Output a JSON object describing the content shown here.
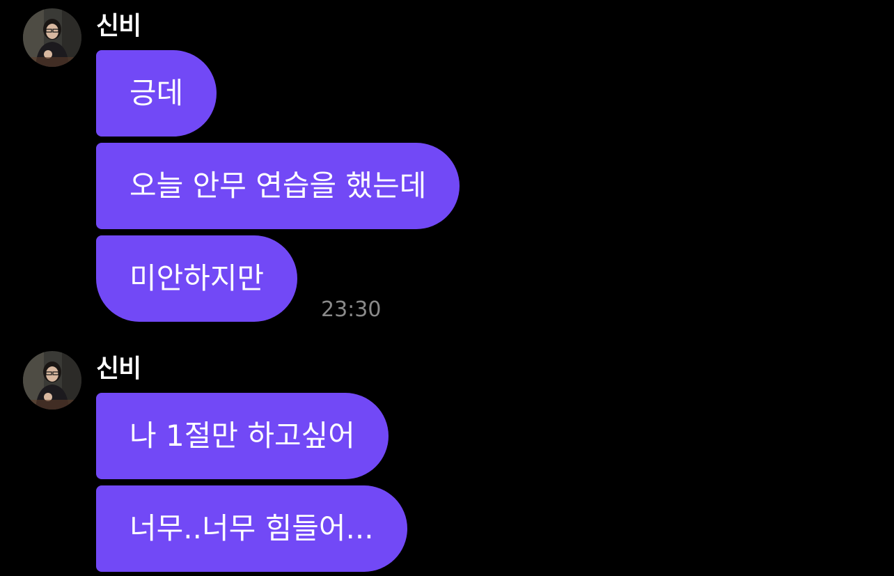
{
  "chat": {
    "groups": [
      {
        "sender": "신비",
        "avatar": "profile-photo",
        "messages": [
          "긍데",
          "오늘 안무 연습을 했는데",
          "미안하지만"
        ],
        "time": "23:30"
      },
      {
        "sender": "신비",
        "avatar": "profile-photo",
        "messages": [
          "나 1절만 하고싶어",
          "너무..너무 힘들어..."
        ]
      }
    ]
  },
  "colors": {
    "background": "#000000",
    "bubble": "#7249f6",
    "text": "#ffffff",
    "time": "#8a8a8a"
  }
}
